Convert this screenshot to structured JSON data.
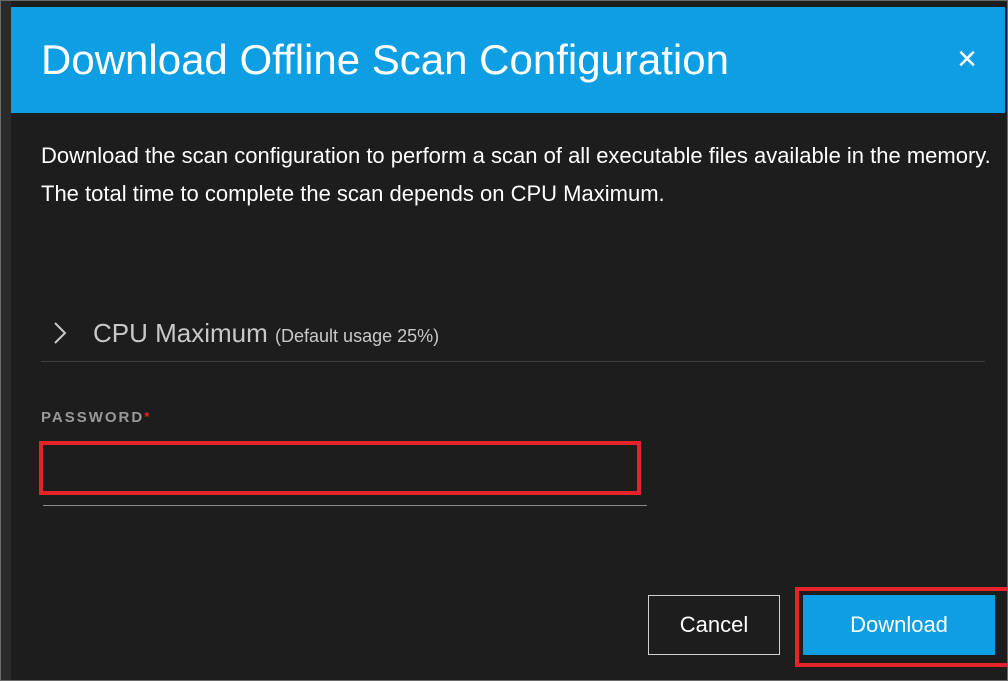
{
  "dialog": {
    "title": "Download Offline Scan Configuration",
    "close_icon": "close-icon",
    "close_glyph": "×",
    "description": "Download the scan configuration to perform a scan of all executable files available in the memory. The total time to complete the scan depends on CPU Maximum."
  },
  "cpu_section": {
    "label": "CPU Maximum",
    "hint": "(Default usage 25%)",
    "expanded": false,
    "icon": "chevron-right-icon"
  },
  "password": {
    "label": "PASSWORD",
    "required_mark": "*",
    "value": "",
    "placeholder": ""
  },
  "buttons": {
    "cancel_label": "Cancel",
    "download_label": "Download"
  },
  "colors": {
    "accent": "#0e9ee3",
    "background": "#1d1d1d",
    "highlight": "#e4232a"
  }
}
